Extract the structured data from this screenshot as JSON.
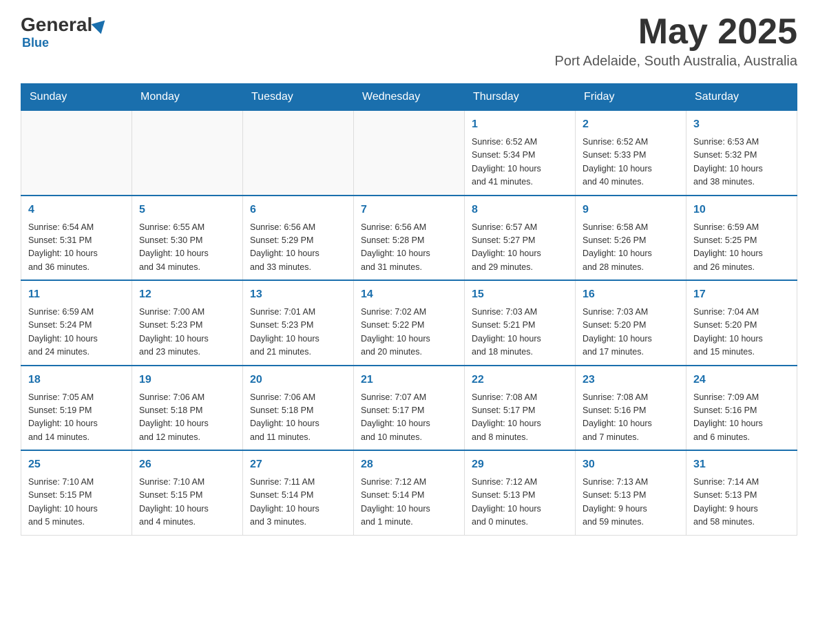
{
  "header": {
    "logo_general": "General",
    "logo_blue": "Blue",
    "month_year": "May 2025",
    "location": "Port Adelaide, South Australia, Australia"
  },
  "weekdays": [
    "Sunday",
    "Monday",
    "Tuesday",
    "Wednesday",
    "Thursday",
    "Friday",
    "Saturday"
  ],
  "weeks": [
    [
      {
        "day": "",
        "info": ""
      },
      {
        "day": "",
        "info": ""
      },
      {
        "day": "",
        "info": ""
      },
      {
        "day": "",
        "info": ""
      },
      {
        "day": "1",
        "info": "Sunrise: 6:52 AM\nSunset: 5:34 PM\nDaylight: 10 hours\nand 41 minutes."
      },
      {
        "day": "2",
        "info": "Sunrise: 6:52 AM\nSunset: 5:33 PM\nDaylight: 10 hours\nand 40 minutes."
      },
      {
        "day": "3",
        "info": "Sunrise: 6:53 AM\nSunset: 5:32 PM\nDaylight: 10 hours\nand 38 minutes."
      }
    ],
    [
      {
        "day": "4",
        "info": "Sunrise: 6:54 AM\nSunset: 5:31 PM\nDaylight: 10 hours\nand 36 minutes."
      },
      {
        "day": "5",
        "info": "Sunrise: 6:55 AM\nSunset: 5:30 PM\nDaylight: 10 hours\nand 34 minutes."
      },
      {
        "day": "6",
        "info": "Sunrise: 6:56 AM\nSunset: 5:29 PM\nDaylight: 10 hours\nand 33 minutes."
      },
      {
        "day": "7",
        "info": "Sunrise: 6:56 AM\nSunset: 5:28 PM\nDaylight: 10 hours\nand 31 minutes."
      },
      {
        "day": "8",
        "info": "Sunrise: 6:57 AM\nSunset: 5:27 PM\nDaylight: 10 hours\nand 29 minutes."
      },
      {
        "day": "9",
        "info": "Sunrise: 6:58 AM\nSunset: 5:26 PM\nDaylight: 10 hours\nand 28 minutes."
      },
      {
        "day": "10",
        "info": "Sunrise: 6:59 AM\nSunset: 5:25 PM\nDaylight: 10 hours\nand 26 minutes."
      }
    ],
    [
      {
        "day": "11",
        "info": "Sunrise: 6:59 AM\nSunset: 5:24 PM\nDaylight: 10 hours\nand 24 minutes."
      },
      {
        "day": "12",
        "info": "Sunrise: 7:00 AM\nSunset: 5:23 PM\nDaylight: 10 hours\nand 23 minutes."
      },
      {
        "day": "13",
        "info": "Sunrise: 7:01 AM\nSunset: 5:23 PM\nDaylight: 10 hours\nand 21 minutes."
      },
      {
        "day": "14",
        "info": "Sunrise: 7:02 AM\nSunset: 5:22 PM\nDaylight: 10 hours\nand 20 minutes."
      },
      {
        "day": "15",
        "info": "Sunrise: 7:03 AM\nSunset: 5:21 PM\nDaylight: 10 hours\nand 18 minutes."
      },
      {
        "day": "16",
        "info": "Sunrise: 7:03 AM\nSunset: 5:20 PM\nDaylight: 10 hours\nand 17 minutes."
      },
      {
        "day": "17",
        "info": "Sunrise: 7:04 AM\nSunset: 5:20 PM\nDaylight: 10 hours\nand 15 minutes."
      }
    ],
    [
      {
        "day": "18",
        "info": "Sunrise: 7:05 AM\nSunset: 5:19 PM\nDaylight: 10 hours\nand 14 minutes."
      },
      {
        "day": "19",
        "info": "Sunrise: 7:06 AM\nSunset: 5:18 PM\nDaylight: 10 hours\nand 12 minutes."
      },
      {
        "day": "20",
        "info": "Sunrise: 7:06 AM\nSunset: 5:18 PM\nDaylight: 10 hours\nand 11 minutes."
      },
      {
        "day": "21",
        "info": "Sunrise: 7:07 AM\nSunset: 5:17 PM\nDaylight: 10 hours\nand 10 minutes."
      },
      {
        "day": "22",
        "info": "Sunrise: 7:08 AM\nSunset: 5:17 PM\nDaylight: 10 hours\nand 8 minutes."
      },
      {
        "day": "23",
        "info": "Sunrise: 7:08 AM\nSunset: 5:16 PM\nDaylight: 10 hours\nand 7 minutes."
      },
      {
        "day": "24",
        "info": "Sunrise: 7:09 AM\nSunset: 5:16 PM\nDaylight: 10 hours\nand 6 minutes."
      }
    ],
    [
      {
        "day": "25",
        "info": "Sunrise: 7:10 AM\nSunset: 5:15 PM\nDaylight: 10 hours\nand 5 minutes."
      },
      {
        "day": "26",
        "info": "Sunrise: 7:10 AM\nSunset: 5:15 PM\nDaylight: 10 hours\nand 4 minutes."
      },
      {
        "day": "27",
        "info": "Sunrise: 7:11 AM\nSunset: 5:14 PM\nDaylight: 10 hours\nand 3 minutes."
      },
      {
        "day": "28",
        "info": "Sunrise: 7:12 AM\nSunset: 5:14 PM\nDaylight: 10 hours\nand 1 minute."
      },
      {
        "day": "29",
        "info": "Sunrise: 7:12 AM\nSunset: 5:13 PM\nDaylight: 10 hours\nand 0 minutes."
      },
      {
        "day": "30",
        "info": "Sunrise: 7:13 AM\nSunset: 5:13 PM\nDaylight: 9 hours\nand 59 minutes."
      },
      {
        "day": "31",
        "info": "Sunrise: 7:14 AM\nSunset: 5:13 PM\nDaylight: 9 hours\nand 58 minutes."
      }
    ]
  ]
}
